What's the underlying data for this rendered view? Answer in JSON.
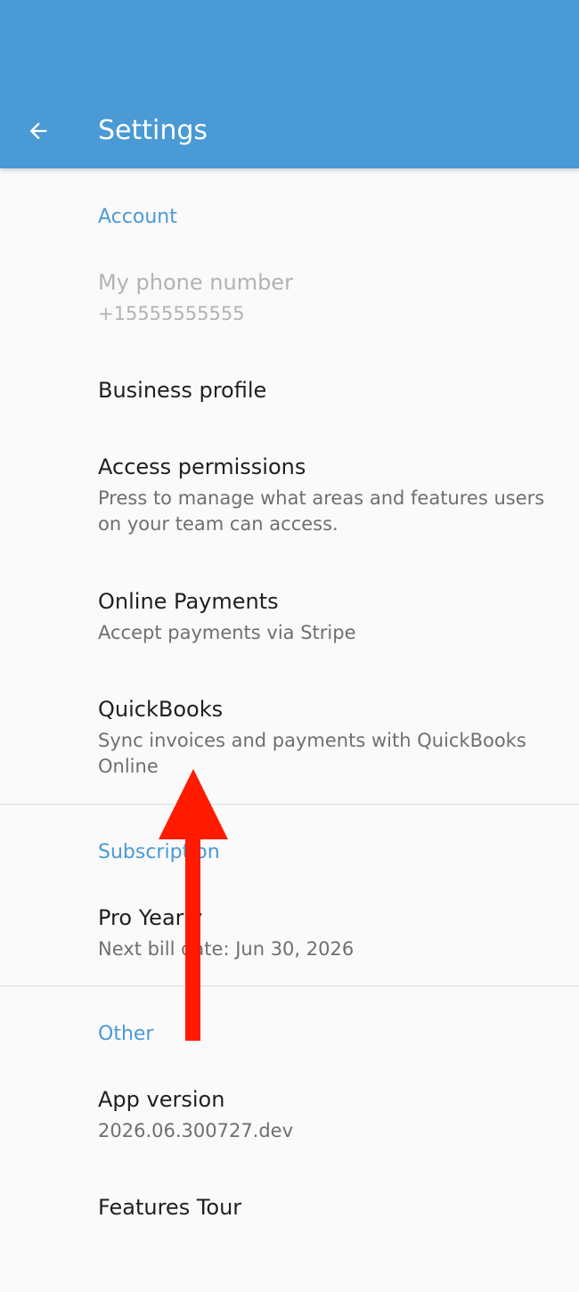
{
  "app_bar": {
    "title": "Settings",
    "back_icon": "arrow-left-icon",
    "color": "#4a9ad6"
  },
  "sections": {
    "account": {
      "header": "Account",
      "phone": {
        "title": "My phone number",
        "value": "+15555555555"
      },
      "business_profile": {
        "title": "Business profile"
      },
      "access_permissions": {
        "title": "Access permissions",
        "subtitle": "Press to manage what areas and features users on your team can access."
      },
      "online_payments": {
        "title": "Online Payments",
        "subtitle": "Accept payments via Stripe"
      },
      "quickbooks": {
        "title": "QuickBooks",
        "subtitle": "Sync invoices and payments with QuickBooks Online"
      }
    },
    "subscription": {
      "header": "Subscription",
      "plan": {
        "title": "Pro Yearly",
        "subtitle": "Next bill date: Jun 30, 2026"
      }
    },
    "other": {
      "header": "Other",
      "app_version": {
        "title": "App version",
        "value": "2026.06.300727.dev"
      },
      "features_tour": {
        "title": "Features Tour"
      }
    }
  },
  "annotation": {
    "icon": "up-arrow-annotation",
    "color": "#ff1a00"
  }
}
